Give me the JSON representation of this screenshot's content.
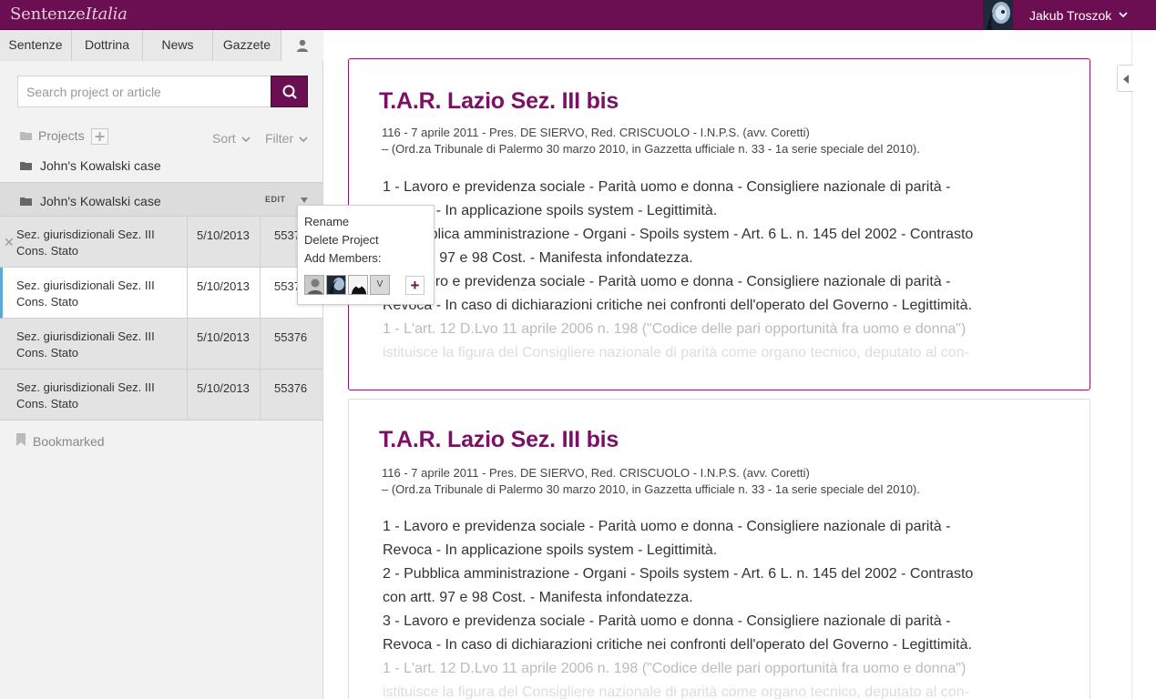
{
  "app": {
    "logo_plain": "Sentenze",
    "logo_italic": "Italia",
    "user_name": "Jakub Troszok"
  },
  "colors": {
    "brand": "#6b0f52",
    "heading": "#7a1164",
    "accent_row": "#5aa9d6"
  },
  "tabs": [
    "Sentenze",
    "Dottrina",
    "News",
    "Gazzete"
  ],
  "search": {
    "placeholder": "Search project or article"
  },
  "projects": {
    "label": "Projects",
    "sort_label": "Sort",
    "filter_label": "Filter",
    "items": [
      "John's Kowalski case",
      "John's Kowalski case"
    ],
    "edit_label": "EDIT"
  },
  "rows": [
    {
      "title": "Sez. giurisdizionali Sez. III Cons. Stato",
      "date": "5/10/2013",
      "code": "55376"
    },
    {
      "title": "Sez. giurisdizionali Sez. III Cons. Stato",
      "date": "5/10/2013",
      "code": "55376"
    },
    {
      "title": "Sez. giurisdizionali Sez. III Cons. Stato",
      "date": "5/10/2013",
      "code": "55376"
    },
    {
      "title": "Sez. giurisdizionali Sez. III Cons. Stato",
      "date": "5/10/2013",
      "code": "55376"
    }
  ],
  "bookmarked_label": "Bookmarked",
  "popover": {
    "rename": "Rename",
    "delete": "Delete Project",
    "add_members": "Add Members:",
    "member_v": "V"
  },
  "cards": [
    {
      "title": "T.A.R. Lazio Sez. III bis",
      "meta1": "116 - 7 aprile 2011 - Pres. DE SIERVO, Red. CRISCUOLO - I.N.P.S. (avv. Coretti)",
      "meta2": "– (Ord.za Tribunale di Palermo 30 marzo 2010, in Gazzetta ufficiale n. 33 - 1a serie speciale del 2010).",
      "p1a": "1 - Lavoro e previdenza sociale - Parità uomo e donna - Consigliere nazionale di parità -",
      "p1b": "Revoca - In applicazione spoils system - Legittimità.",
      "p2a": "2 - Pubblica amministrazione - Organi - Spoils system - Art. 6 L. n. 145 del 2002 - Contrasto",
      "p2b": "con artt. 97 e 98 Cost. - Manifesta infondatezza.",
      "p3a": "3 - Lavoro e previdenza sociale - Parità uomo e donna - Consigliere nazionale di parità -",
      "p3b": "Revoca - In caso di dichiarazioni critiche nei confronti dell'operato del Governo - Legittimità.",
      "p4a": "1 - L'art. 12 D.Lvo 11 aprile 2006 n. 198 (\"Codice delle pari opportunità fra uomo e donna\")",
      "p4b": "istituisce la figura del Consigliere nazionale di parità come organo tecnico, deputato al con-"
    },
    {
      "title": "T.A.R. Lazio Sez. III bis",
      "meta1": "116 - 7 aprile 2011 - Pres. DE SIERVO, Red. CRISCUOLO - I.N.P.S. (avv. Coretti)",
      "meta2": "– (Ord.za Tribunale di Palermo 30 marzo 2010, in Gazzetta ufficiale n. 33 - 1a serie speciale del 2010).",
      "p1a": "1 - Lavoro e previdenza sociale - Parità uomo e donna - Consigliere nazionale di parità -",
      "p1b": "Revoca - In applicazione spoils system - Legittimità.",
      "p2a": "2 - Pubblica amministrazione - Organi - Spoils system - Art. 6 L. n. 145 del 2002 - Contrasto",
      "p2b": "con artt. 97 e 98 Cost. - Manifesta infondatezza.",
      "p3a": "3 - Lavoro e previdenza sociale - Parità uomo e donna - Consigliere nazionale di parità -",
      "p3b": "Revoca - In caso di dichiarazioni critiche nei confronti dell'operato del Governo - Legittimità.",
      "p4a": "1 - L'art. 12 D.Lvo 11 aprile 2006 n. 198 (\"Codice delle pari opportunità fra uomo e donna\")",
      "p4b": "istituisce la figura del Consigliere nazionale di parità come organo tecnico, deputato al con-"
    }
  ]
}
